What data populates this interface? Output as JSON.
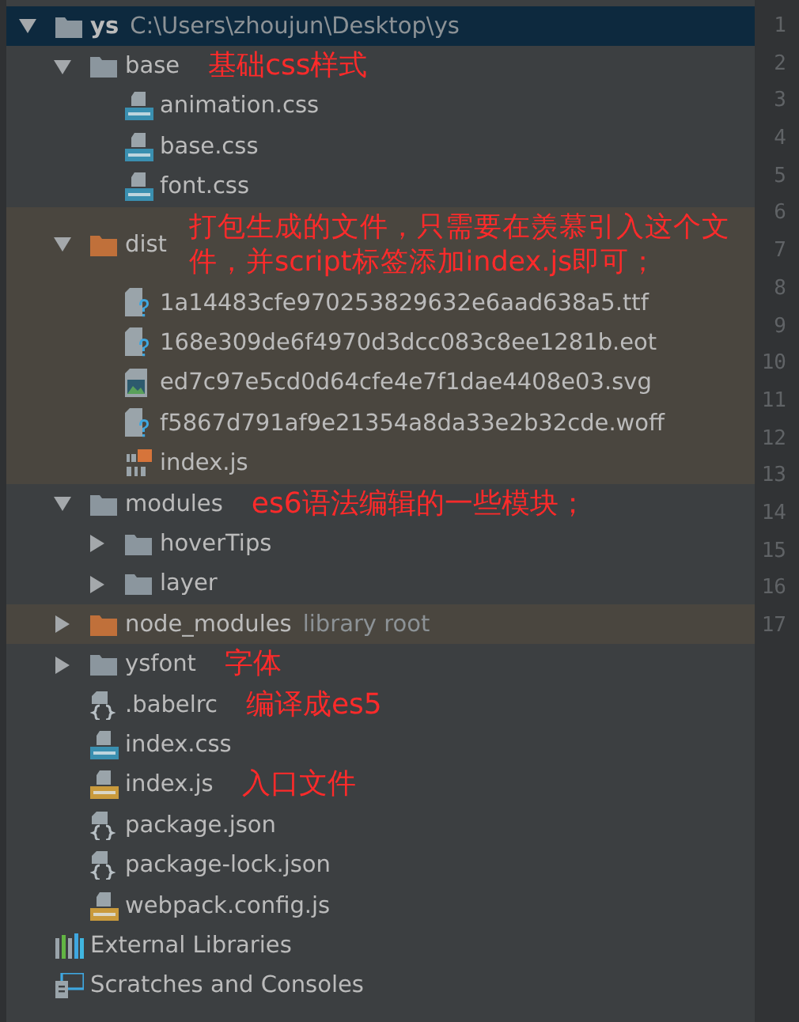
{
  "tree": [
    {
      "name": "ys",
      "detail": "C:\\Users\\zhoujun\\Desktop\\ys",
      "kind": "folder",
      "expanded": true,
      "selected": true,
      "excluded": false,
      "children": [
        {
          "name": "base",
          "kind": "folder",
          "expanded": true,
          "selected": false,
          "excluded": false,
          "note": "基础css样式",
          "children": [
            {
              "name": "animation.css",
              "kind": "css",
              "selected": false
            },
            {
              "name": "base.css",
              "kind": "css",
              "selected": false
            },
            {
              "name": "font.css",
              "kind": "css",
              "selected": false
            }
          ]
        },
        {
          "name": "dist",
          "kind": "folder",
          "expanded": true,
          "selected": false,
          "excluded": true,
          "note": "打包生成的文件，只需要在羡慕引入这个文件，并script标签添加index.js即可；",
          "children": [
            {
              "name": "1a14483cfe970253829632e6aad638a5.ttf",
              "kind": "unknown",
              "selected": false
            },
            {
              "name": "168e309de6f4970d3dcc083c8ee1281b.eot",
              "kind": "unknown",
              "selected": false
            },
            {
              "name": "ed7c97e5cd0d64cfe4e7f1dae4408e03.svg",
              "kind": "image",
              "selected": false
            },
            {
              "name": "f5867d791af9e21354a8da33e2b32cde.woff",
              "kind": "unknown",
              "selected": false
            },
            {
              "name": "index.js",
              "kind": "js-binary",
              "selected": false
            }
          ]
        },
        {
          "name": "modules",
          "kind": "folder",
          "expanded": true,
          "selected": false,
          "excluded": false,
          "note": "es6语法编辑的一些模块；",
          "children": [
            {
              "name": "hoverTips",
              "kind": "folder",
              "expanded": false,
              "selected": false,
              "excluded": false
            },
            {
              "name": "layer",
              "kind": "folder",
              "expanded": false,
              "selected": false,
              "excluded": false
            }
          ]
        },
        {
          "name": "node_modules",
          "detail": "library root",
          "kind": "folder",
          "expanded": false,
          "selected": false,
          "excluded": true
        },
        {
          "name": "ysfont",
          "kind": "folder",
          "expanded": false,
          "selected": false,
          "excluded": false,
          "note": "字体"
        },
        {
          "name": ".babelrc",
          "kind": "json",
          "selected": false,
          "note": "编译成es5"
        },
        {
          "name": "index.css",
          "kind": "css",
          "selected": false
        },
        {
          "name": "index.js",
          "kind": "js",
          "selected": false,
          "note": "入口文件"
        },
        {
          "name": "package.json",
          "kind": "json",
          "selected": false
        },
        {
          "name": "package-lock.json",
          "kind": "json",
          "selected": false
        },
        {
          "name": "webpack.config.js",
          "kind": "js",
          "selected": false
        }
      ]
    },
    {
      "name": "External Libraries",
      "kind": "libraries",
      "selected": false
    },
    {
      "name": "Scratches and Consoles",
      "kind": "scratches",
      "selected": false
    }
  ],
  "gutter": {
    "line_numbers": [
      "1",
      "2",
      "3",
      "4",
      "5",
      "6",
      "7",
      "8",
      "9",
      "10",
      "11",
      "12",
      "13",
      "14",
      "15",
      "16",
      "17"
    ]
  }
}
